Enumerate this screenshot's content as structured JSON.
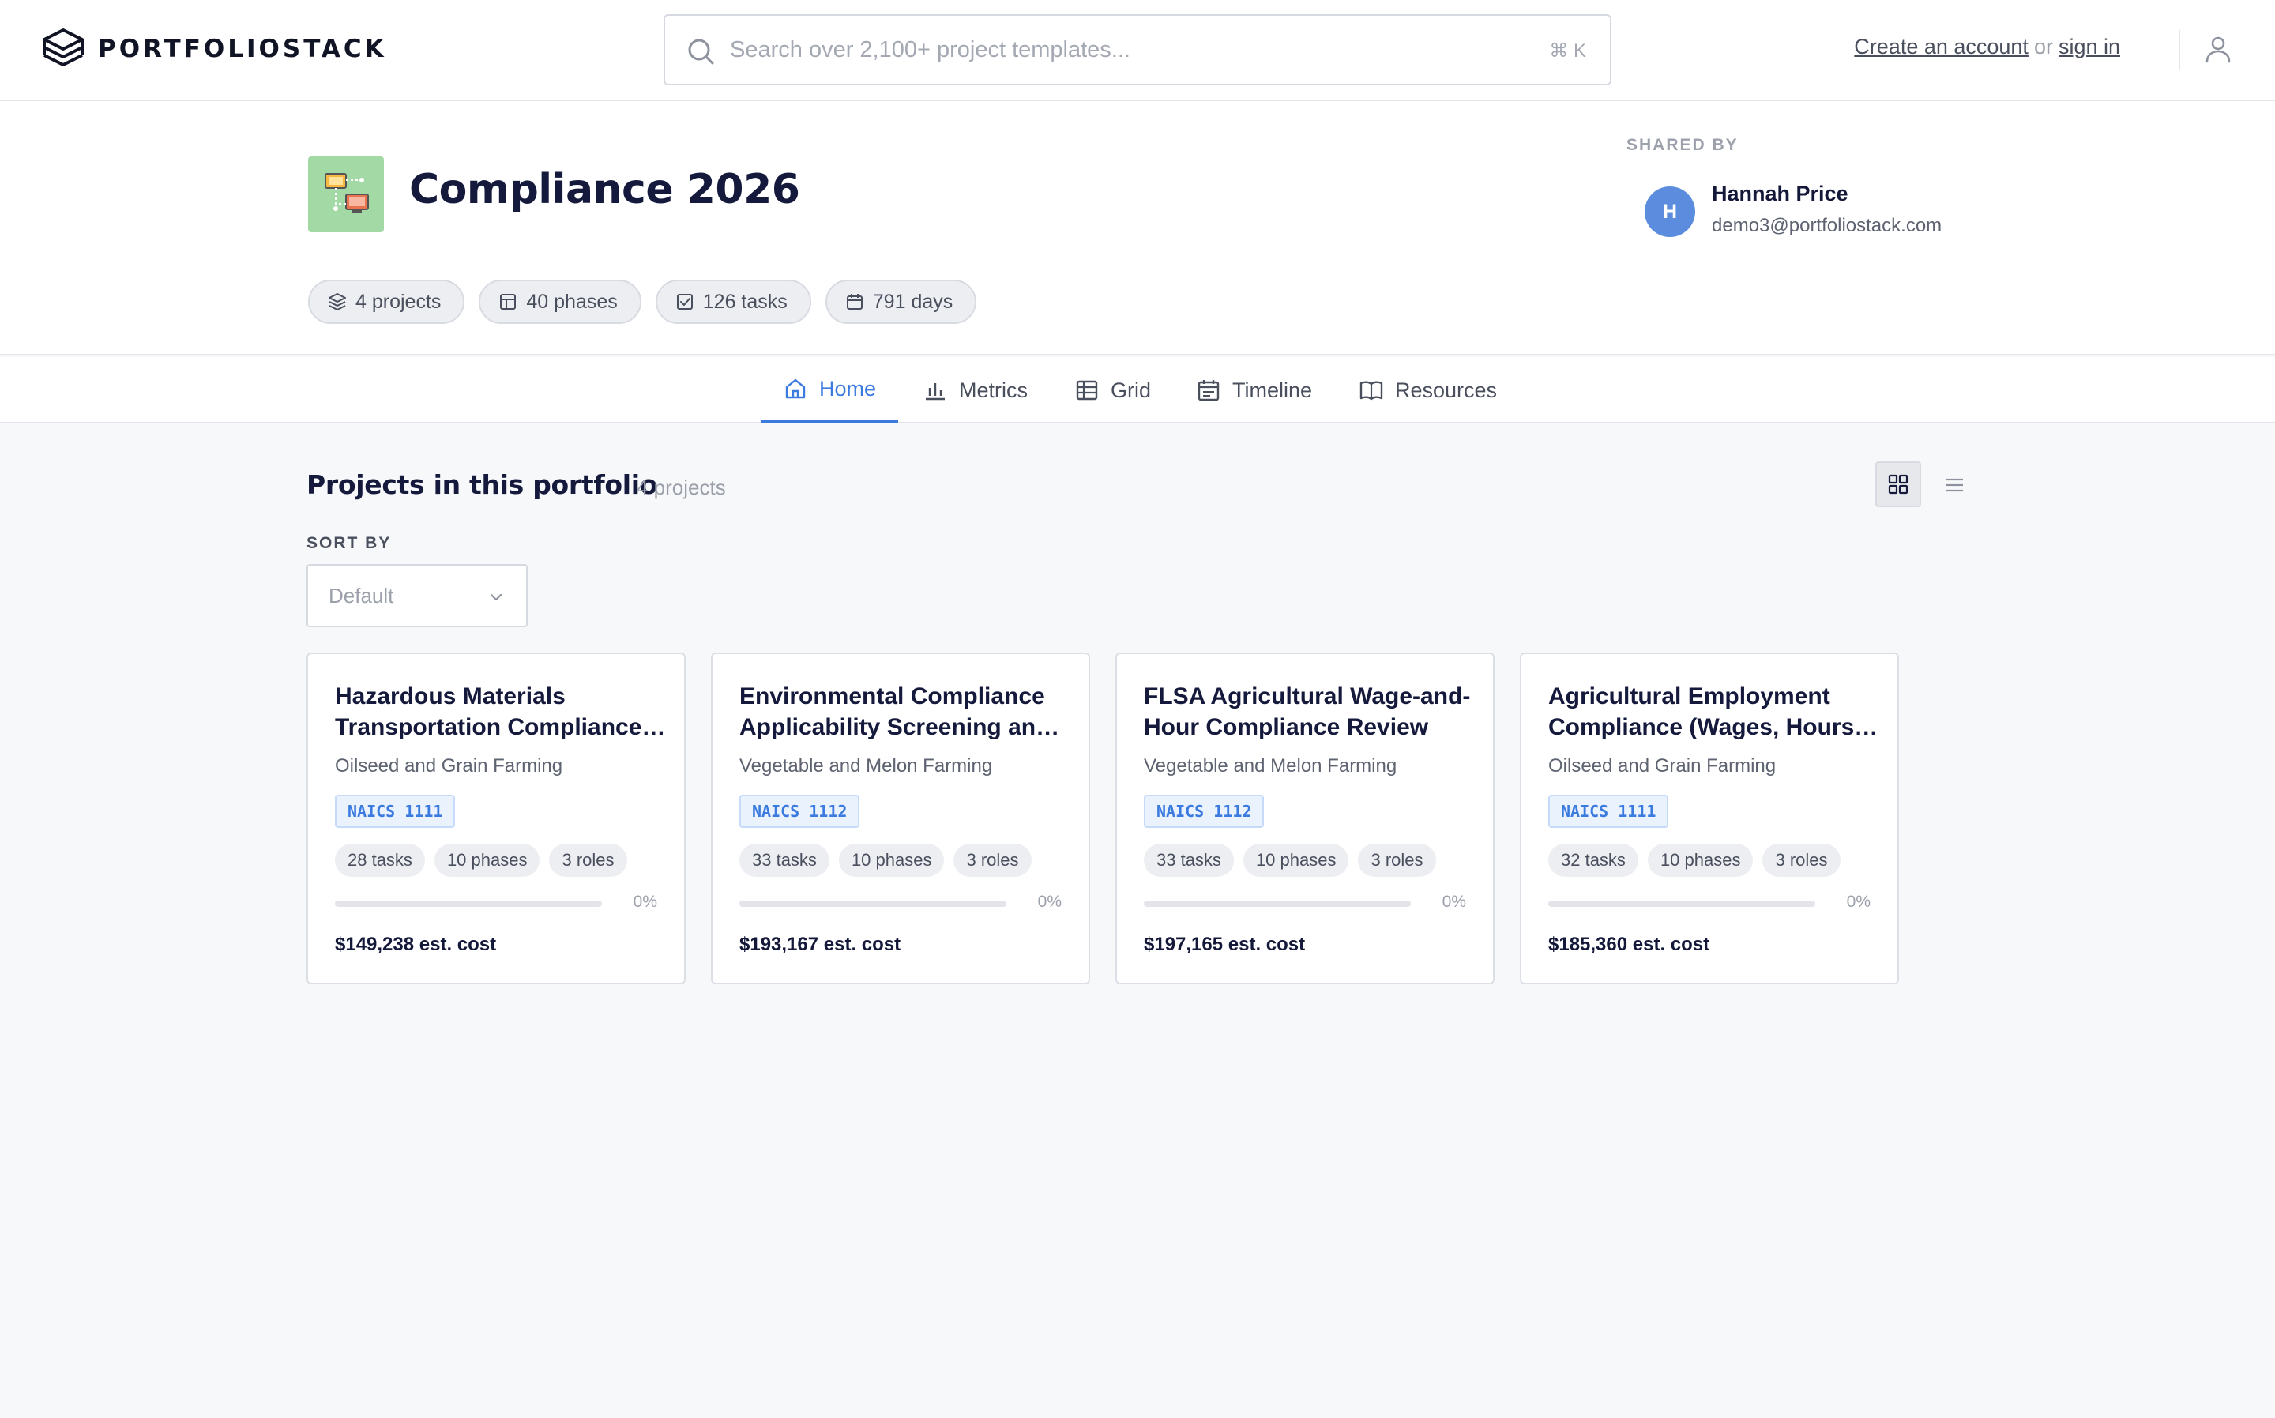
{
  "brand": {
    "name": "PORTFOLIOSTACK",
    "icon": "stack-logo-icon"
  },
  "search": {
    "placeholder": "Search over 2,100+ project templates...",
    "shortcut": "⌘ K"
  },
  "auth": {
    "create_account": "Create an account",
    "or": "or",
    "sign_in": "sign in"
  },
  "portfolio": {
    "title": "Compliance 2026",
    "stats": [
      {
        "icon": "layers-icon",
        "label": "4 projects"
      },
      {
        "icon": "layout-icon",
        "label": "40 phases"
      },
      {
        "icon": "checkbox-icon",
        "label": "126 tasks"
      },
      {
        "icon": "calendar-icon",
        "label": "791 days"
      }
    ],
    "shared_by": {
      "label": "SHARED BY",
      "initial": "H",
      "name": "Hannah Price",
      "email": "demo3@portfoliostack.com",
      "avatar_color": "#5b8cde"
    }
  },
  "tabs": [
    {
      "label": "Home",
      "icon": "home-icon",
      "active": true
    },
    {
      "label": "Metrics",
      "icon": "bar-chart-icon",
      "active": false
    },
    {
      "label": "Grid",
      "icon": "table-icon",
      "active": false
    },
    {
      "label": "Timeline",
      "icon": "calendar-icon",
      "active": false
    },
    {
      "label": "Resources",
      "icon": "book-icon",
      "active": false
    }
  ],
  "main": {
    "section_title": "Projects in this portfolio",
    "section_count": "4 projects",
    "sort": {
      "label": "SORT BY",
      "value": "Default"
    },
    "projects": [
      {
        "title": "Hazardous Materials Transportation Compliance Program",
        "industry": "Oilseed and Grain Farming",
        "naics": "NAICS 1111",
        "tasks": "28 tasks",
        "phases": "10 phases",
        "roles": "3 roles",
        "progress": 0,
        "progress_label": "0%",
        "cost": "$149,238 est. cost"
      },
      {
        "title": "Environmental Compliance Applicability Screening and Assessment",
        "industry": "Vegetable and Melon Farming",
        "naics": "NAICS 1112",
        "tasks": "33 tasks",
        "phases": "10 phases",
        "roles": "3 roles",
        "progress": 0,
        "progress_label": "0%",
        "cost": "$193,167 est. cost"
      },
      {
        "title": "FLSA Agricultural Wage-and-Hour Compliance Review",
        "industry": "Vegetable and Melon Farming",
        "naics": "NAICS 1112",
        "tasks": "33 tasks",
        "phases": "10 phases",
        "roles": "3 roles",
        "progress": 0,
        "progress_label": "0%",
        "cost": "$197,165 est. cost"
      },
      {
        "title": "Agricultural Employment Compliance (Wages, Hours and Safety)",
        "industry": "Oilseed and Grain Farming",
        "naics": "NAICS 1111",
        "tasks": "32 tasks",
        "phases": "10 phases",
        "roles": "3 roles",
        "progress": 0,
        "progress_label": "0%",
        "cost": "$185,360 est. cost"
      }
    ]
  },
  "colors": {
    "accent": "#3b7be0",
    "portfolio_icon_bg": "#a3d9a5",
    "naics_bg": "#eaf2fe"
  }
}
